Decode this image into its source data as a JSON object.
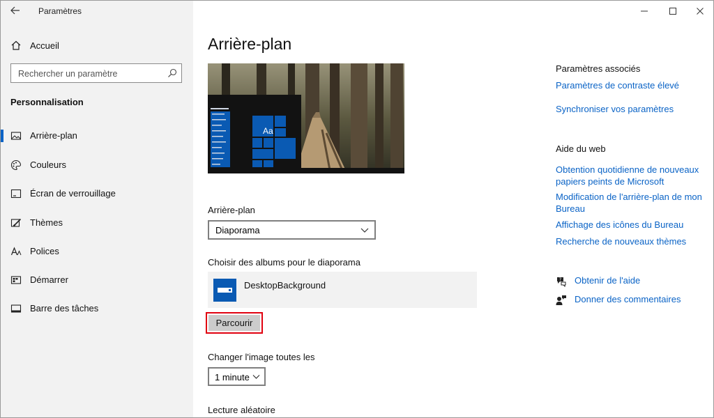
{
  "window": {
    "title": "Paramètres",
    "controls": {
      "minimize_icon": "minimize-icon",
      "maximize_icon": "maximize-icon",
      "close_icon": "close-icon"
    }
  },
  "sidebar": {
    "home_label": "Accueil",
    "search_placeholder": "Rechercher un paramètre",
    "section_title": "Personnalisation",
    "items": [
      {
        "label": "Arrière-plan",
        "icon": "picture-icon",
        "active": true
      },
      {
        "label": "Couleurs",
        "icon": "palette-icon",
        "active": false
      },
      {
        "label": "Écran de verrouillage",
        "icon": "lock-screen-icon",
        "active": false
      },
      {
        "label": "Thèmes",
        "icon": "brush-icon",
        "active": false
      },
      {
        "label": "Polices",
        "icon": "font-icon",
        "active": false
      },
      {
        "label": "Démarrer",
        "icon": "start-icon",
        "active": false
      },
      {
        "label": "Barre des tâches",
        "icon": "taskbar-icon",
        "active": false
      }
    ]
  },
  "main": {
    "title": "Arrière-plan",
    "preview_tile_text": "Aa",
    "background_label": "Arrière-plan",
    "background_value": "Diaporama",
    "albums_label": "Choisir des albums pour le diaporama",
    "album_name": "DesktopBackground",
    "browse_label": "Parcourir",
    "interval_label": "Changer l'image toutes les",
    "interval_value": "1 minute",
    "shuffle_label": "Lecture aléatoire"
  },
  "related": {
    "title": "Paramètres associés",
    "links": [
      "Paramètres de contraste élevé",
      "Synchroniser vos paramètres"
    ]
  },
  "web_help": {
    "title": "Aide du web",
    "links": [
      "Obtention quotidienne de nouveaux papiers peints de Microsoft",
      "Modification de l'arrière-plan de mon Bureau",
      "Affichage des icônes du Bureau",
      "Recherche de nouveaux thèmes"
    ]
  },
  "help": {
    "get_help": "Obtenir de l'aide",
    "feedback": "Donner des commentaires"
  },
  "colors": {
    "accent": "#0a63c6",
    "sidebar_bg": "#f2f2f2",
    "highlight": "#e0000f"
  }
}
